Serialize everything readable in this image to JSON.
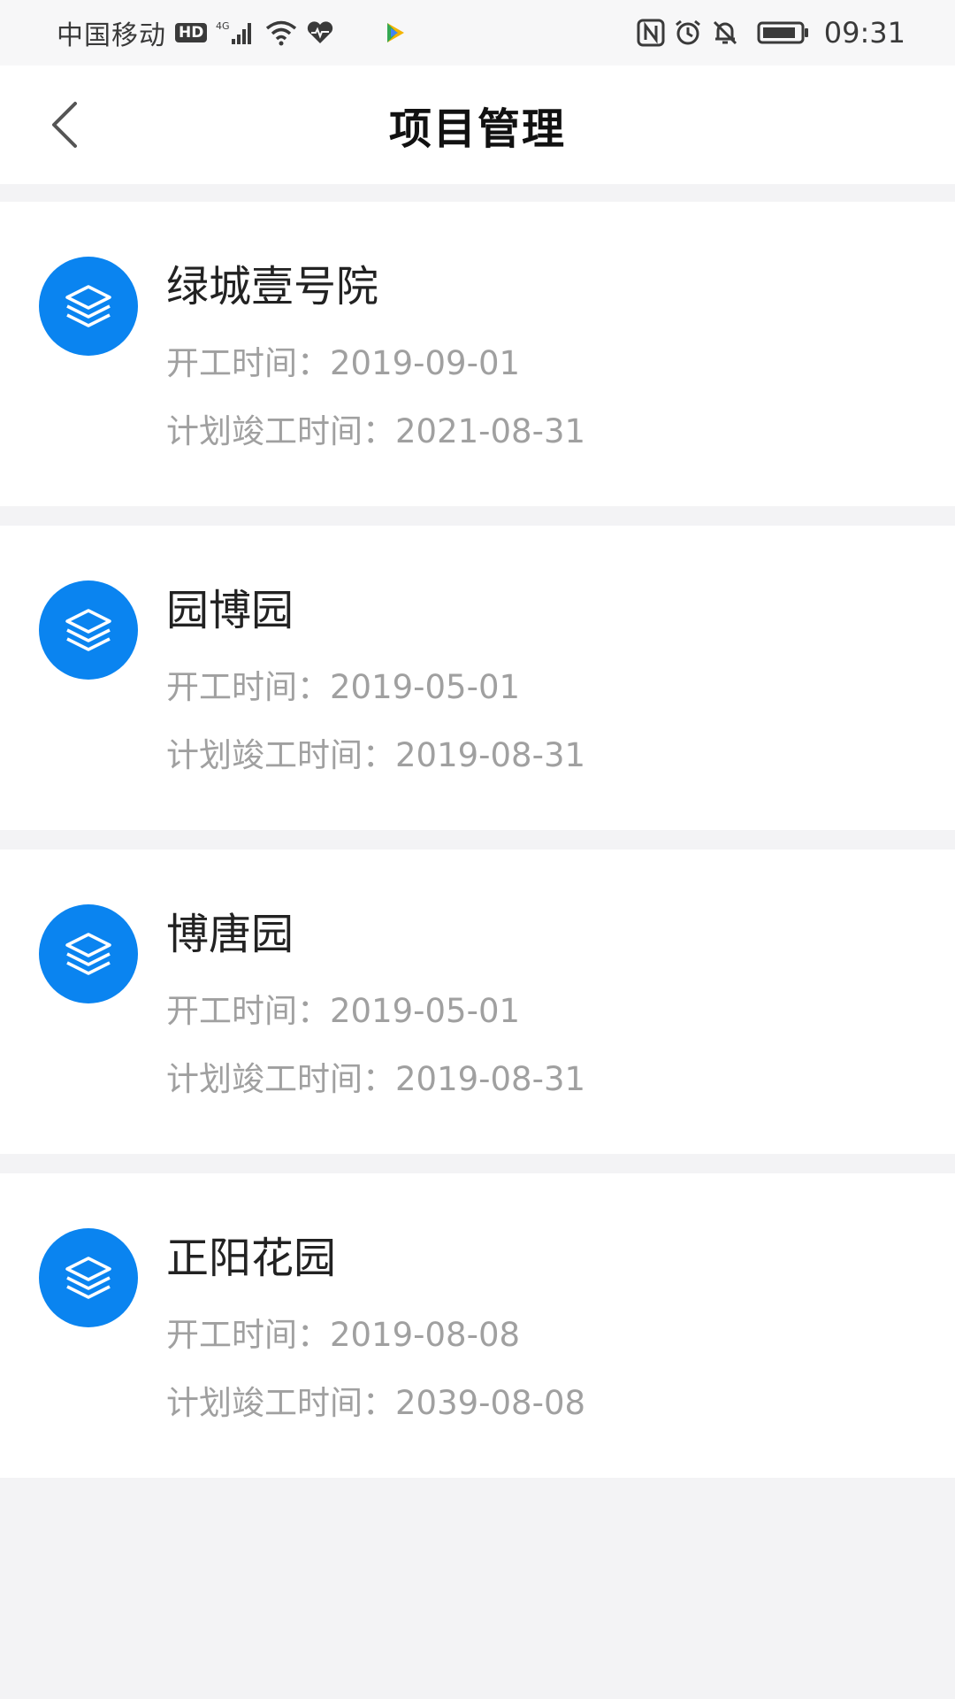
{
  "status_bar": {
    "carrier": "中国移动",
    "hd": "HD",
    "network": "4G",
    "time": "09:31"
  },
  "header": {
    "title": "项目管理"
  },
  "projects": [
    {
      "name": "绿城壹号院",
      "start_label": "开工时间：",
      "start_date": "2019-09-01",
      "end_label": "计划竣工时间：",
      "end_date": "2021-08-31"
    },
    {
      "name": "园博园",
      "start_label": "开工时间：",
      "start_date": "2019-05-01",
      "end_label": "计划竣工时间：",
      "end_date": "2019-08-31"
    },
    {
      "name": "博唐园",
      "start_label": "开工时间：",
      "start_date": "2019-05-01",
      "end_label": "计划竣工时间：",
      "end_date": "2019-08-31"
    },
    {
      "name": "正阳花园",
      "start_label": "开工时间：",
      "start_date": "2019-08-08",
      "end_label": "计划竣工时间：",
      "end_date": "2039-08-08"
    }
  ],
  "colors": {
    "accent": "#0a84f0",
    "muted_text": "#a0a0a0",
    "background": "#f3f3f5"
  },
  "icons": {
    "back": "chevron-left-icon",
    "project": "layers-icon"
  }
}
